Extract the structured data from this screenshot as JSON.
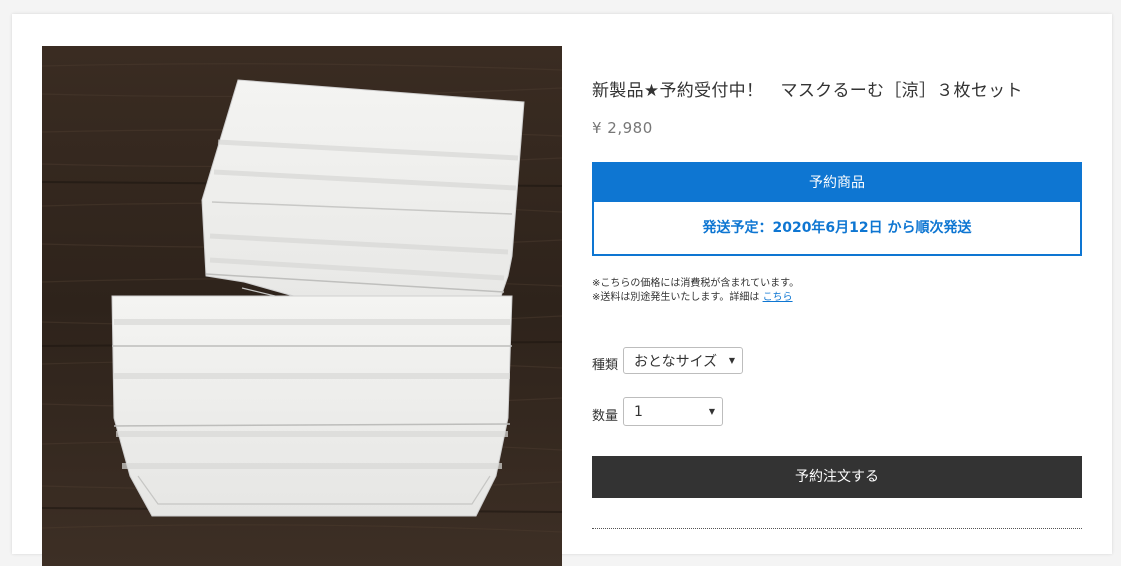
{
  "product": {
    "title": "新製品★予約受付中！　マスクるーむ［涼］３枚セット",
    "price": "¥ 2,980"
  },
  "preorder": {
    "header": "予約商品",
    "shipping": "発送予定：2020年6月12日 から順次発送"
  },
  "notes": {
    "tax": "※こちらの価格には消費税が含まれています。",
    "shipping_prefix": "※送料は別途発生いたします。詳細は ",
    "shipping_link": "こちら"
  },
  "options": {
    "type_label": "種類",
    "type_value": "おとなサイズ",
    "qty_label": "数量",
    "qty_value": "1"
  },
  "order_button": "予約注文する",
  "colors": {
    "accent": "#0e76d2",
    "button": "#333333"
  }
}
